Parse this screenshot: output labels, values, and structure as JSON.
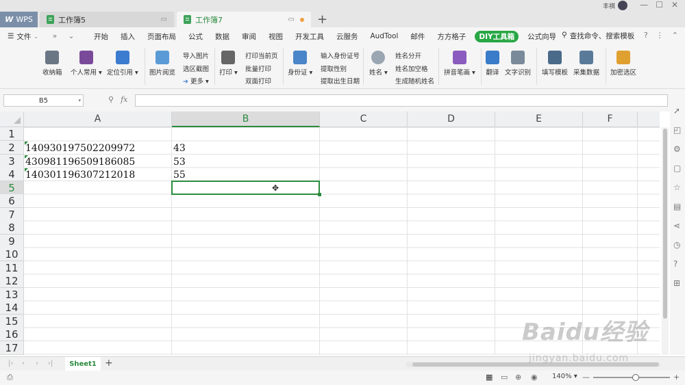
{
  "titlebar": {
    "app": "WPS",
    "tabs": [
      {
        "label": "工作簿5",
        "active": false
      },
      {
        "label": "工作簿7",
        "active": true
      }
    ],
    "user": "丰祺"
  },
  "menu": {
    "file": "文件",
    "items": [
      "开始",
      "插入",
      "页面布局",
      "公式",
      "数据",
      "审阅",
      "视图",
      "开发工具",
      "云服务",
      "AudTool",
      "邮件",
      "方方格子"
    ],
    "diy": "DIY工具箱",
    "after_diy": "公式向导",
    "search": "查找命令、搜索模板"
  },
  "ribbon": {
    "big_buttons": [
      {
        "label": "收纳箱",
        "color": "#6a7684"
      },
      {
        "label": "个人常用",
        "color": "#7a4a9a"
      },
      {
        "label": "定位引用",
        "color": "#3b7bd0"
      },
      {
        "label": "图片阅览",
        "color": "#5a9bd6"
      },
      {
        "label": "打印",
        "color": "#666666"
      },
      {
        "label": "身份证",
        "color": "#4a86c8"
      },
      {
        "label": "姓名",
        "color": "#9aa6b2"
      },
      {
        "label": "拼音笔画",
        "color": "#8a5cc0"
      },
      {
        "label": "翻译",
        "color": "#3a7cc8"
      },
      {
        "label": "文字识别",
        "color": "#7a8a9a"
      },
      {
        "label": "填写模板",
        "color": "#4a6a8a"
      },
      {
        "label": "采集数据",
        "color": "#5a7a9a"
      },
      {
        "label": "加密选区",
        "color": "#e0a030"
      }
    ],
    "small_buttons": {
      "image": [
        "导入图片",
        "选区截图",
        "更多"
      ],
      "print": [
        "打印当前页",
        "批量打印",
        "双面打印"
      ],
      "id": [
        "输入身份证号",
        "提取性别",
        "提取出生日期"
      ],
      "name": [
        "姓名分开",
        "姓名加空格",
        "生成随机姓名"
      ]
    }
  },
  "formula_bar": {
    "name_box": "B5",
    "fx": "fx",
    "content": ""
  },
  "sheet": {
    "columns": [
      "A",
      "B",
      "C",
      "D",
      "E",
      "F"
    ],
    "selected_column": "B",
    "rows": [
      "1",
      "2",
      "3",
      "4",
      "5",
      "6",
      "7",
      "8",
      "9",
      "10",
      "11",
      "12",
      "13",
      "14",
      "15",
      "16",
      "17"
    ],
    "selected_row": "5",
    "selected_cell": "B5",
    "cells": [
      {
        "ref": "A2",
        "value": "140930197502209972"
      },
      {
        "ref": "B2",
        "value": "43"
      },
      {
        "ref": "A3",
        "value": "430981196509186085"
      },
      {
        "ref": "B3",
        "value": "53"
      },
      {
        "ref": "A4",
        "value": "140301196307212018"
      },
      {
        "ref": "B4",
        "value": "55"
      }
    ]
  },
  "sheet_tabs": {
    "active": "Sheet1"
  },
  "status": {
    "zoom": "140%"
  },
  "watermark": {
    "text": "Baidu经验",
    "url": "jingyan.baidu.com"
  },
  "colors": {
    "accent": "#2a8b3e",
    "diy_badge": "#28a745"
  }
}
